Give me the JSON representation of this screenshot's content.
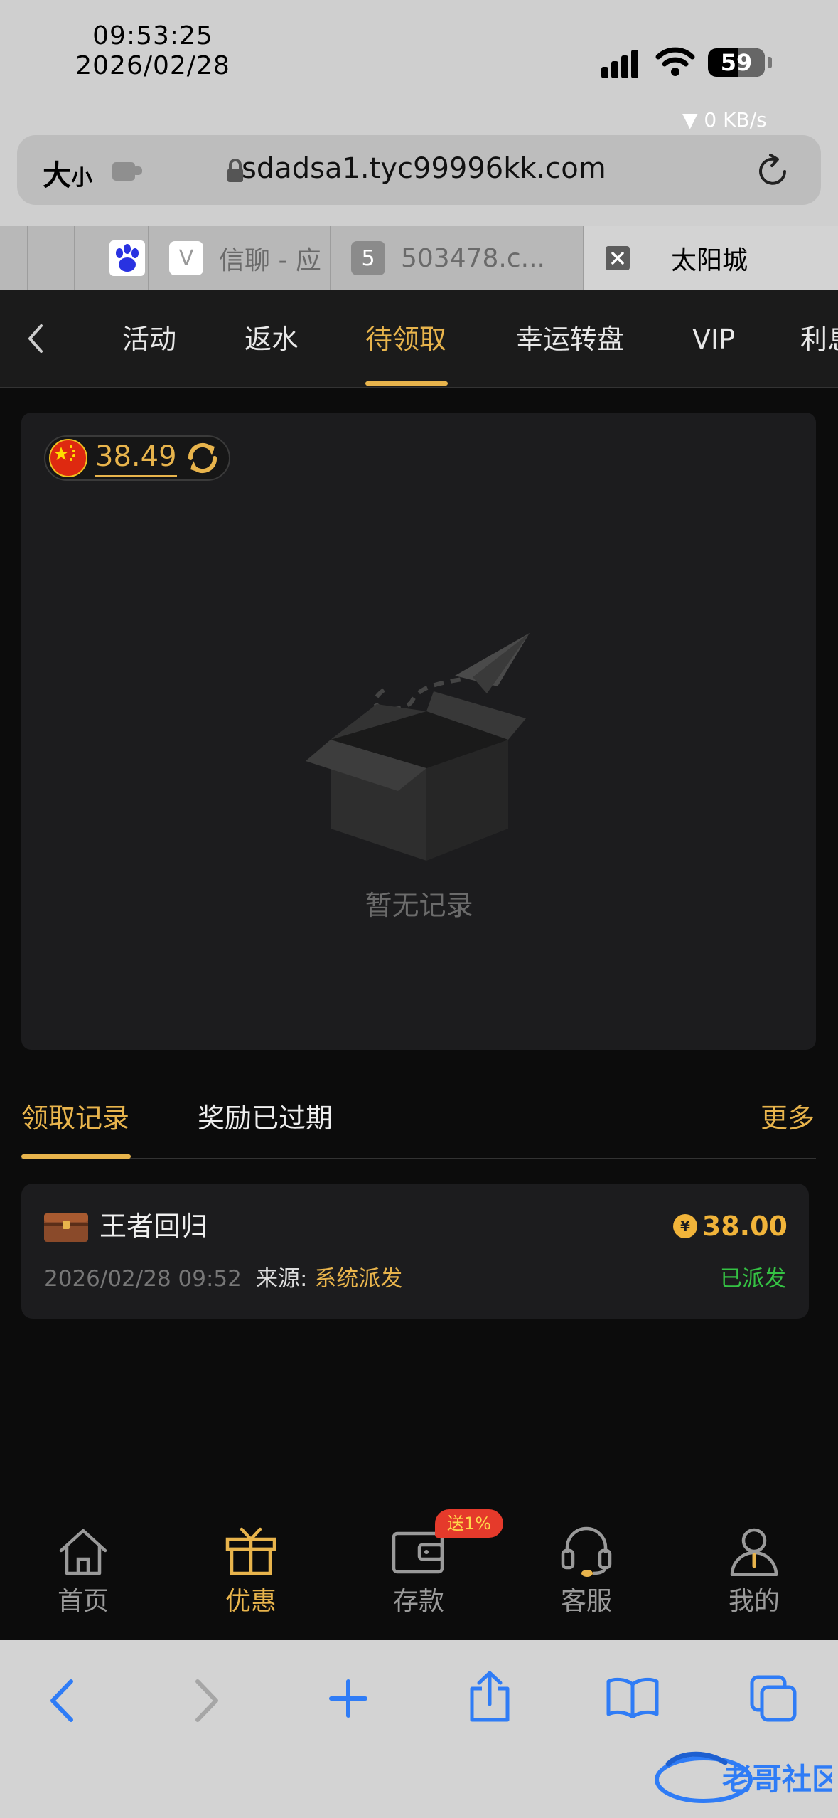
{
  "status_bar": {
    "time": "09:53:25",
    "date": "2026/02/28",
    "battery": "59",
    "net_speed": "▼ 0 KB/s"
  },
  "browser": {
    "reader_label": "大",
    "reader_small": "小",
    "url": "sdadsa1.tyc99996kk.com",
    "tabs": [
      {
        "label": ""
      },
      {
        "label": ""
      },
      {
        "badge": "V",
        "label": "信聊 - 应"
      },
      {
        "badge": "5",
        "label": "503478.c..."
      },
      {
        "label": "太阳城"
      }
    ]
  },
  "categories": {
    "items": [
      "活动",
      "返水",
      "待领取",
      "幸运转盘",
      "VIP",
      "利息"
    ],
    "active_index": 2
  },
  "panel": {
    "balance": "38.49",
    "empty_text": "暂无记录"
  },
  "record_tabs": {
    "claimed": "领取记录",
    "expired": "奖励已过期",
    "more": "更多"
  },
  "record": {
    "title": "王者回归",
    "amount": "38.00",
    "time": "2026/02/28 09:52",
    "source_label": "来源:",
    "source_value": "系统派发",
    "status": "已派发"
  },
  "tabbar": {
    "items": [
      "首页",
      "优惠",
      "存款",
      "客服",
      "我的"
    ],
    "deposit_badge": "送1%",
    "active_index": 1
  },
  "watermark": "老哥社区",
  "colors": {
    "accent": "#e8b44c",
    "amount": "#f1b43a",
    "success": "#35c244",
    "badge": "#e53a2b"
  }
}
